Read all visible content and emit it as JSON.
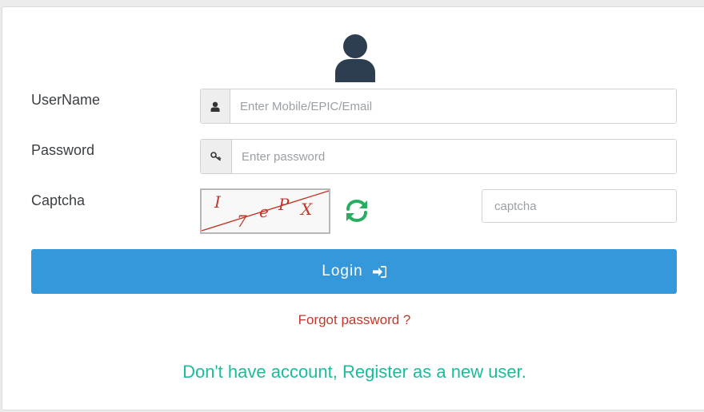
{
  "form": {
    "username_label": "UserName",
    "username_placeholder": "Enter Mobile/EPIC/Email",
    "password_label": "Password",
    "password_placeholder": "Enter password",
    "captcha_label": "Captcha",
    "captcha_text": "I 7eP X",
    "captcha_placeholder": "captcha",
    "login_label": "Login",
    "forgot_label": "Forgot password ?",
    "register_label": "Don't have account, Register as a new user."
  },
  "icons": {
    "avatar": "user-avatar-icon",
    "username": "user-icon",
    "password": "key-icon",
    "refresh": "refresh-icon",
    "login": "sign-in-icon"
  },
  "colors": {
    "primary": "#3498db",
    "avatar": "#2c3e50",
    "refresh": "#27ae60",
    "forgot": "#c0392b",
    "register": "#1abc9c",
    "captcha_text": "#c0392b"
  }
}
